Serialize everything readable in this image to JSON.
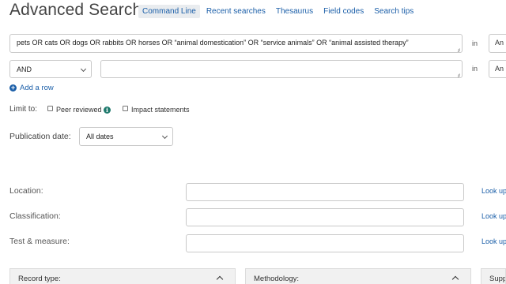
{
  "header": {
    "title": "Advanced Search",
    "tabs": [
      {
        "label": "Command Line",
        "active": true
      },
      {
        "label": "Recent searches",
        "active": false
      },
      {
        "label": "Thesaurus",
        "active": false
      },
      {
        "label": "Field codes",
        "active": false
      },
      {
        "label": "Search tips",
        "active": false
      }
    ]
  },
  "search": {
    "row1": {
      "query": "pets OR cats OR dogs OR rabbits OR horses OR “animal domestication” OR “service animals”  OR “animal assisted therapy”",
      "in_label": "in",
      "field": "An"
    },
    "row2": {
      "operator": "AND",
      "query": "",
      "in_label": "in",
      "field": "An"
    },
    "add_row_label": "Add a row"
  },
  "limits": {
    "label": "Limit to:",
    "peer_reviewed": {
      "label": "Peer reviewed",
      "checked": false
    },
    "impact_statements": {
      "label": "Impact statements",
      "checked": false
    }
  },
  "publication_date": {
    "label": "Publication date:",
    "value": "All dates"
  },
  "lookups": [
    {
      "label": "Location:",
      "link": "Look up"
    },
    {
      "label": "Classification:",
      "link": "Look up"
    },
    {
      "label": "Test & measure:",
      "link": "Look up"
    }
  ],
  "panels": [
    {
      "label": "Record type:"
    },
    {
      "label": "Methodology:"
    },
    {
      "label": "Supp"
    }
  ],
  "colors": {
    "link": "#1a5ea8",
    "active_tab_bg": "#e9ecef",
    "info_icon": "#1f7a6d"
  }
}
